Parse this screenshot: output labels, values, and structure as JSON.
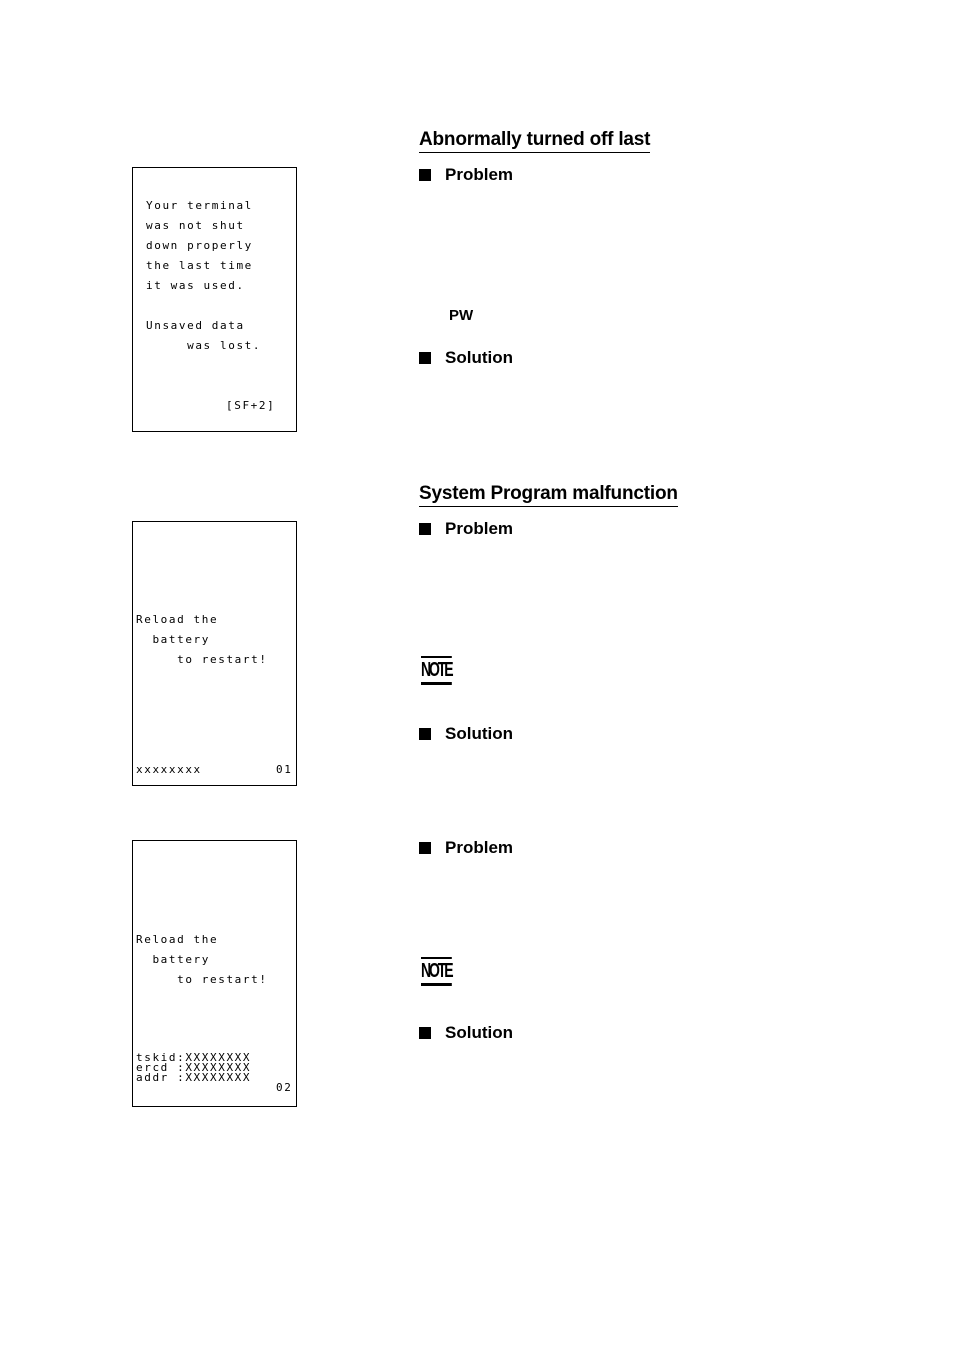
{
  "section1": {
    "title": "Abnormally turned off last",
    "problem_label": "Problem",
    "pw_label": "PW",
    "solution_label": "Solution",
    "screen": {
      "lines": [
        "Your terminal",
        "was not shut",
        "down properly",
        "the last time",
        "it was used.",
        "Unsaved data",
        "     was lost.",
        "[SF+2]"
      ]
    }
  },
  "section2": {
    "title": "System Program malfunction",
    "problem_label": "Problem",
    "note_label": "NOTE",
    "solution_label": "Solution",
    "screen": {
      "lines": [
        "Reload the",
        "  battery",
        "     to restart!"
      ],
      "footer_left": "xxxxxxxx",
      "footer_right": "01"
    }
  },
  "section3": {
    "problem_label": "Problem",
    "note_label": "NOTE",
    "solution_label": "Solution",
    "screen": {
      "lines": [
        "Reload the",
        "  battery",
        "     to restart!"
      ],
      "diag_lines": [
        "tskid:XXXXXXXX",
        "ercd :XXXXXXXX",
        "addr :XXXXXXXX"
      ],
      "code": "02"
    }
  }
}
